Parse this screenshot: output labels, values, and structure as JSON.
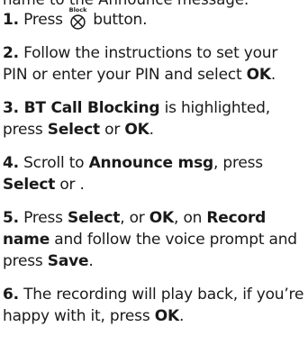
{
  "top_line": "name to the Announce message.",
  "block_icon": {
    "name": "block-icon",
    "label": "Block"
  },
  "steps": [
    {
      "num": "1.",
      "before": " Press ",
      "after": " button."
    },
    {
      "num": "2.",
      "text_a": " Follow the instructions to set your PIN or enter your PIN and select ",
      "bold_a": "OK",
      "text_b": "."
    },
    {
      "num": "3.",
      "bold_a": " BT Call Blocking",
      "text_a": " is highlighted, press ",
      "bold_b": "Select",
      "text_b": " or ",
      "bold_c": "OK",
      "text_c": "."
    },
    {
      "num": "4.",
      "text_a": " Scroll to ",
      "bold_a": "Announce msg",
      "text_b": ", press ",
      "bold_b": "Select",
      "text_c": " or ."
    },
    {
      "num": "5.",
      "text_a": " Press ",
      "bold_a": "Select",
      "text_b": ", or ",
      "bold_b": "OK",
      "text_c": ", on ",
      "bold_c": "Record name",
      "text_d": " and follow the voice prompt and press ",
      "bold_d": "Save",
      "text_e": "."
    },
    {
      "num": "6.",
      "text_a": " The recording will play back, if you’re happy with it, press ",
      "bold_a": "OK",
      "text_b": "."
    }
  ]
}
